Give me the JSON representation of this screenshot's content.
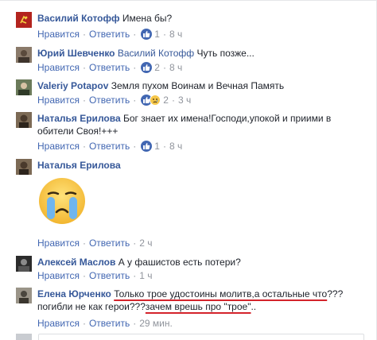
{
  "comments": [
    {
      "author": "Василий Котофф",
      "reply_to": "",
      "text": "Имена бы?",
      "like_label": "Нравится",
      "reply_label": "Ответить",
      "reaction_count": "1",
      "time": "8 ч",
      "reactions": [
        "like"
      ]
    },
    {
      "author": "Юрий Шевченко",
      "reply_to": "Василий Котофф",
      "text": "Чуть позже...",
      "like_label": "Нравится",
      "reply_label": "Ответить",
      "reaction_count": "2",
      "time": "8 ч",
      "reactions": [
        "like"
      ]
    },
    {
      "author": "Valeriy Potapov",
      "reply_to": "",
      "text": "Земля пухом Воинам и Вечная Память",
      "like_label": "Нравится",
      "reply_label": "Ответить",
      "reaction_count": "2",
      "time": "3 ч",
      "reactions": [
        "like",
        "sad"
      ]
    },
    {
      "author": "Наталья Ерилова",
      "reply_to": "",
      "text": "Бог знает их имена!Господи,упокой и приими в обители Своя!+++",
      "like_label": "Нравится",
      "reply_label": "Ответить",
      "reaction_count": "1",
      "time": "8 ч",
      "reactions": [
        "like"
      ]
    },
    {
      "author": "Наталья Ерилова",
      "reply_to": "",
      "text": "",
      "sticker": "crying-face-sticker",
      "like_label": "Нравится",
      "reply_label": "Ответить",
      "reaction_count": "",
      "time": "2 ч",
      "reactions": []
    },
    {
      "author": "Алексей Маслов",
      "reply_to": "",
      "text": "А у фашистов есть потери?",
      "like_label": "Нравится",
      "reply_label": "Ответить",
      "reaction_count": "",
      "time": "1 ч",
      "reactions": []
    },
    {
      "author": "Елена Юрченко",
      "reply_to": "",
      "text_part1": "Только трое удостоины молитв,а остальные что",
      "text_part2": "??? погибли не как герои???",
      "text_part3": "зачем врешь про \"трое\"",
      "text_part4": "..",
      "like_label": "Нравится",
      "reply_label": "Ответить",
      "reaction_count": "",
      "time": "29 мин.",
      "reactions": []
    }
  ],
  "colors": {
    "author": "#365899",
    "meta": "#90949c",
    "link": "#4267b2",
    "like_badge": "#4267b2",
    "sad_badge": "#f6c74a",
    "annotation_red": "#d4232b"
  }
}
